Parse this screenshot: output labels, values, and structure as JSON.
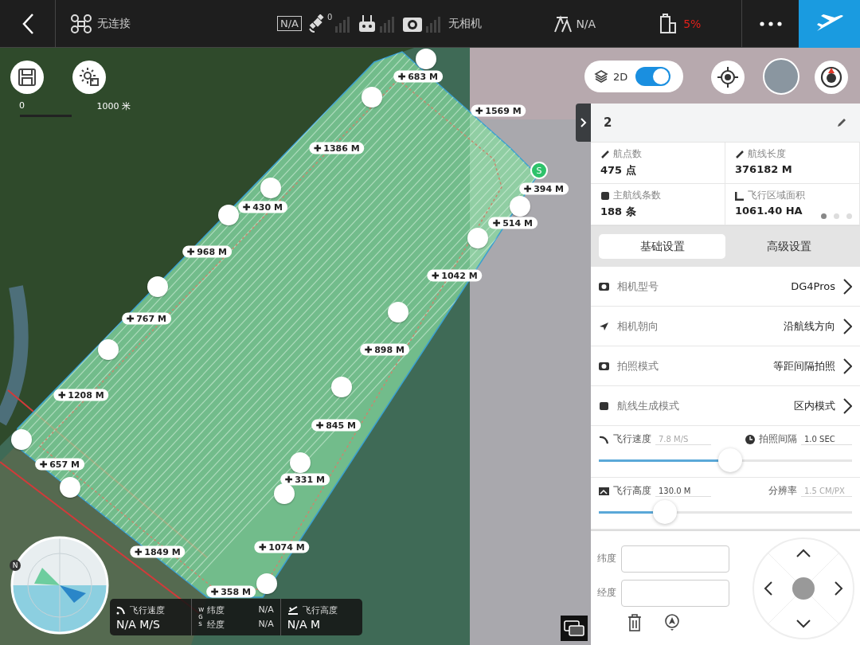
{
  "top_bar": {
    "connection": "无连接",
    "gps_badge": "N/A",
    "satellite_count": "0",
    "camera": "无相机",
    "altitude": "N/A",
    "battery": "5%"
  },
  "map": {
    "scale": [
      "0",
      "1000 米"
    ],
    "mode_toggle": {
      "label": "2D",
      "on": true
    },
    "distance_labels": [
      "683 M",
      "1569 M",
      "1386 M",
      "394 M",
      "430 M",
      "514 M",
      "968 M",
      "1042 M",
      "767 M",
      "898 M",
      "1208 M",
      "845 M",
      "657 M",
      "331 M",
      "1849 M",
      "1074 M",
      "358 M"
    ],
    "start_marker": "S",
    "compass_north": "N"
  },
  "telemetry": {
    "speed_label": "飞行速度",
    "speed": "N/A M/S",
    "datum": [
      "W",
      "G",
      "S"
    ],
    "lat_label": "纬度",
    "lat": "N/A",
    "lon_label": "经度",
    "lon": "N/A",
    "height_label": "飞行高度",
    "height": "N/A M"
  },
  "panel": {
    "title": "2",
    "stats": [
      {
        "label": "航点数",
        "value": "475 点"
      },
      {
        "label": "航线长度",
        "value": "376182 M"
      },
      {
        "label": "主航线条数",
        "value": "188 条"
      },
      {
        "label": "飞行区域面积",
        "value": "1061.40 HA"
      }
    ],
    "pages": [
      {
        "selected": true
      },
      {
        "selected": false
      },
      {
        "selected": false
      }
    ],
    "tabs": [
      {
        "label": "基础设置",
        "selected": true
      },
      {
        "label": "高级设置",
        "selected": false
      }
    ],
    "settings": [
      {
        "label": "相机型号",
        "value": "DG4Pros"
      },
      {
        "label": "相机朝向",
        "value": "沿航线方向"
      },
      {
        "label": "拍照模式",
        "value": "等距间隔拍照"
      },
      {
        "label": "航线生成模式",
        "value": "区内模式"
      }
    ],
    "sliders": [
      {
        "label": "飞行速度",
        "value": "7.8 M/S",
        "side_label": "拍照间隔",
        "side_value": "1.0 SEC",
        "level": 0.52
      },
      {
        "label": "飞行高度",
        "value": "130.0 M",
        "side_label": "分辨率",
        "side_value": "1.5 CM/PX",
        "level": 0.26
      }
    ],
    "coordinates": [
      {
        "label": "纬度"
      },
      {
        "label": "经度"
      }
    ]
  }
}
